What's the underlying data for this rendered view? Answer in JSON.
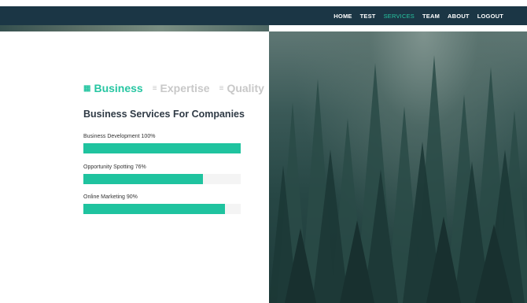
{
  "nav": {
    "items": [
      {
        "label": "HOME"
      },
      {
        "label": "TEST"
      },
      {
        "label": "SERVICES"
      },
      {
        "label": "TEAM"
      },
      {
        "label": "ABOUT"
      },
      {
        "label": "LOGOUT"
      }
    ],
    "active": "SERVICES"
  },
  "tabs": [
    {
      "label": "Business",
      "icon": "grid-icon",
      "active": true
    },
    {
      "label": "Expertise",
      "icon": "list-icon",
      "active": false
    },
    {
      "label": "Quality",
      "icon": "list-icon",
      "active": false
    }
  ],
  "section": {
    "title": "Business Services For Companies"
  },
  "skills": [
    {
      "label": "Business Development 100%",
      "percent": 100
    },
    {
      "label": "Opportunity Spotting 76%",
      "percent": 76
    },
    {
      "label": "Online Marketing 90%",
      "percent": 90
    }
  ],
  "colors": {
    "accent": "#1fc39f",
    "navbar": "#1b3645",
    "tab_inactive": "#c8c8c8"
  }
}
